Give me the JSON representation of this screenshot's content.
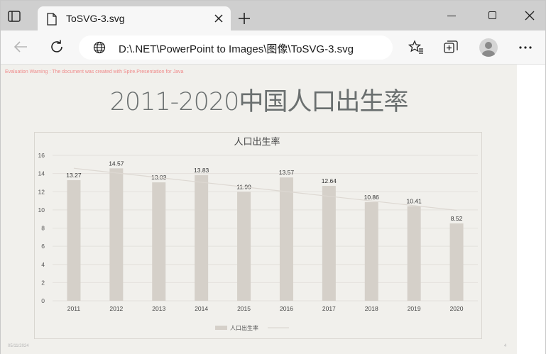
{
  "browser": {
    "tab_title": "ToSVG-3.svg",
    "address": "D:\\.NET\\PowerPoint to Images\\图像\\ToSVG-3.svg"
  },
  "slide": {
    "eval_warning": "Evaluation Warning : The document was created with  Spire.Presentation for Java",
    "title": "2011-2020中国人口出生率",
    "date": "05/11/2024",
    "page_number": "4"
  },
  "chart_data": {
    "type": "bar",
    "title": "人口出生率",
    "categories": [
      "2011",
      "2012",
      "2013",
      "2014",
      "2015",
      "2016",
      "2017",
      "2018",
      "2019",
      "2020"
    ],
    "series": [
      {
        "name": "人口出生率",
        "values": [
          13.27,
          14.57,
          13.03,
          13.83,
          11.99,
          13.57,
          12.64,
          10.86,
          10.41,
          8.52
        ]
      }
    ],
    "data_labels": [
      "13.27",
      "14.57",
      "13.03",
      "13.83",
      "11.99",
      "13.57",
      "12.64",
      "10.86",
      "10.41",
      "8.52"
    ],
    "yticks": [
      "0",
      "2",
      "4",
      "6",
      "8",
      "10",
      "12",
      "14",
      "16"
    ],
    "ylim": [
      0,
      16
    ],
    "trendline": true,
    "grid": true,
    "legend": "bottom",
    "colors": {
      "bar": "#d5d0c9",
      "trend": "#ddd8d2",
      "grid": "#e4e1dc"
    }
  }
}
